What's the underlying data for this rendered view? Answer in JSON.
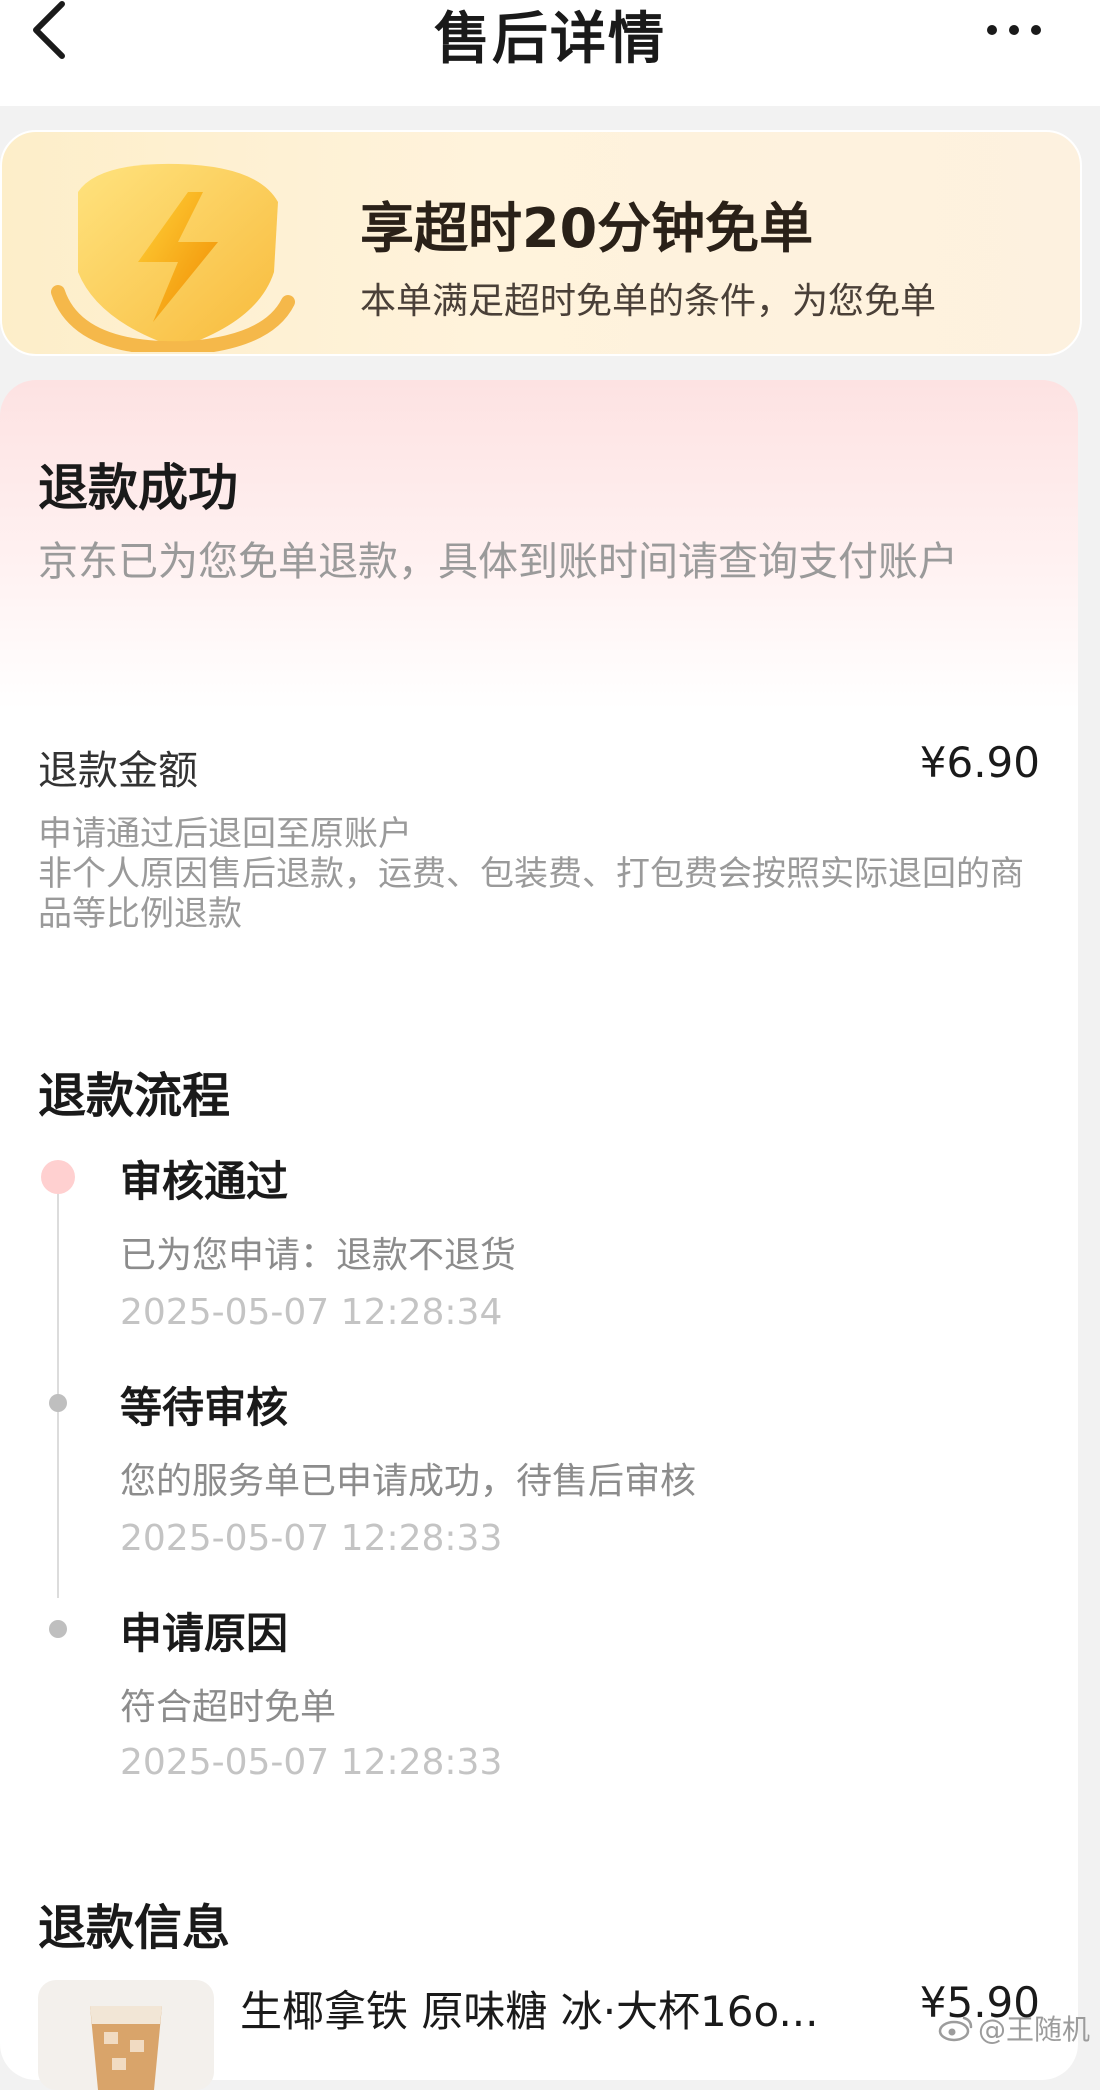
{
  "header": {
    "title": "售后详情"
  },
  "promo": {
    "title": "享超时20分钟免单",
    "subtitle": "本单满足超时免单的条件，为您免单"
  },
  "status": {
    "title": "退款成功",
    "description": "京东已为您免单退款，具体到账时间请查询支付账户"
  },
  "refund": {
    "amount_label": "退款金额",
    "amount_value": "¥6.90",
    "note_line1": "申请通过后退回至原账户",
    "note_line2": "非个人原因售后退款，运费、包装费、打包费会按照实际退回的商品等比例退款"
  },
  "process": {
    "section_title": "退款流程",
    "steps": [
      {
        "title": "审核通过",
        "desc": "已为您申请：退款不退货",
        "time": "2025-05-07 12:28:34"
      },
      {
        "title": "等待审核",
        "desc": "您的服务单已申请成功，待售后审核",
        "time": "2025-05-07 12:28:33"
      },
      {
        "title": "申请原因",
        "desc": "符合超时免单",
        "time": "2025-05-07 12:28:33"
      }
    ]
  },
  "info": {
    "section_title": "退款信息",
    "product_name": "生椰拿铁 原味糖 冰·大杯16o...",
    "product_price": "¥5.90"
  },
  "watermark": "@王随机",
  "colors": {
    "promo_bg": "#fdeec9",
    "status_bg": "#fde2e2",
    "active_dot": "#ffd0d0",
    "inactive_dot": "#bfbfbf"
  },
  "icons": [
    "back-arrow-icon",
    "more-dots-icon",
    "lightning-shield-icon",
    "weibo-icon"
  ]
}
